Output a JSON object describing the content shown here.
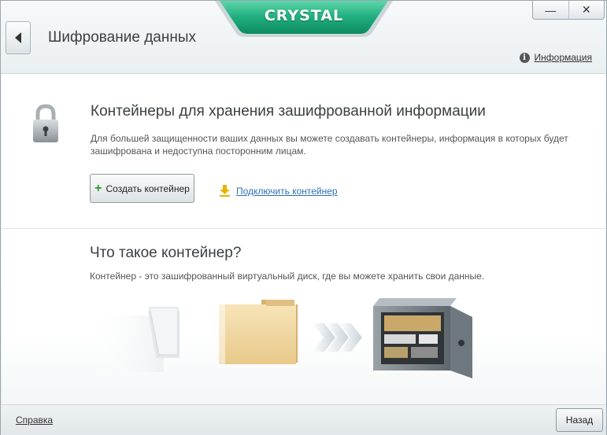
{
  "brand": "CRYSTAL",
  "window": {
    "minimize_label": "—",
    "close_label": "✕"
  },
  "header": {
    "title": "Шифрование данных",
    "info_label": "Информация",
    "info_icon": "info-icon"
  },
  "section_containers": {
    "heading": "Контейнеры для хранения зашифрованной информации",
    "description": "Для большей защищенности ваших данных вы можете создавать контейнеры, информация в которых будет зашифрована и недоступна посторонним лицам.",
    "create_button": "Создать контейнер",
    "connect_link": "Подключить контейнер"
  },
  "section_what": {
    "heading": "Что такое контейнер?",
    "description": "Контейнер - это зашифрованный виртуальный диск, где вы можете хранить свои данные."
  },
  "footer": {
    "help": "Справка",
    "back": "Назад"
  },
  "colors": {
    "brand_green": "#1fae7e",
    "link_blue": "#2f6fb3",
    "plus_green": "#2f9a2a",
    "download_yellow": "#e6b400"
  }
}
